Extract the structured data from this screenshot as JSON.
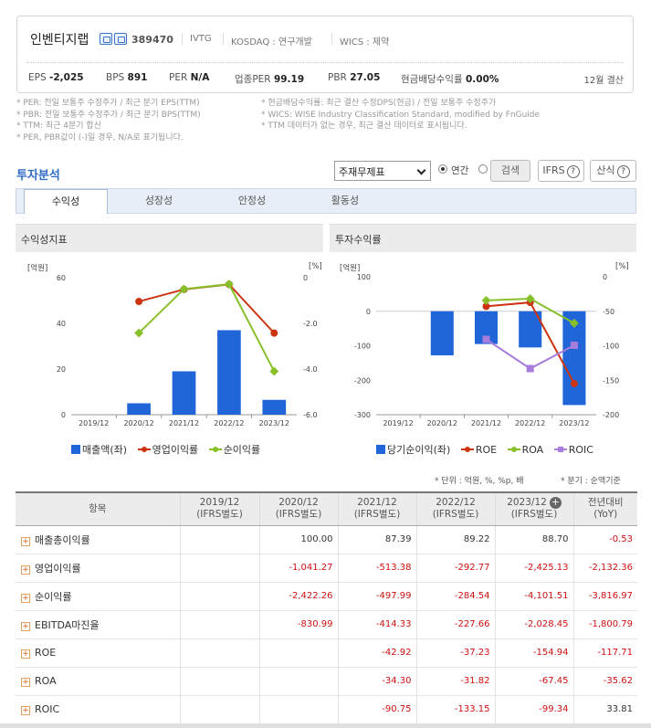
{
  "company": {
    "name": "인벤티지랩",
    "code": "389470",
    "ticker": "IVTG",
    "market": "KOSDAQ : 연구개발",
    "wics": "WICS : 제약",
    "settlement": "12월 결산"
  },
  "metrics": [
    {
      "label": "EPS",
      "value": "-2,025"
    },
    {
      "label": "BPS",
      "value": "891"
    },
    {
      "label": "PER",
      "value": "N/A"
    },
    {
      "label": "업종PER",
      "value": "99.19"
    },
    {
      "label": "PBR",
      "value": "27.05"
    },
    {
      "label": "현금배당수익률",
      "value": "0.00%"
    }
  ],
  "notes_left": [
    "* PER: 전일 보통주 수정주가 / 최근 분기 EPS(TTM)",
    "* PBR: 전일 보통주 수정주가 / 최근 분기 BPS(TTM)",
    "* TTM: 최근 4분기 합산",
    "* PER, PBR값이 (-)일 경우, N/A로 표기됩니다."
  ],
  "notes_right": [
    "* 현금배당수익률: 최근 결산 수정DPS(현금) / 전일 보통주 수정주가",
    "* WICS: WISE Industry Classification Standard, modified by FnGuide",
    "* TTM 데이터가 없는 경우, 최근 결산 데이터로 표시됩니다."
  ],
  "section_title": "투자분석",
  "controls": {
    "select": "주재무제표",
    "radio_annual": "연간",
    "radio_quarter": "분기",
    "search": "검색",
    "ifrs": "IFRS",
    "calc": "산식"
  },
  "tabs": [
    "수익성",
    "성장성",
    "안정성",
    "활동성"
  ],
  "panel_left_title": "수익성지표",
  "panel_right_title": "투자수익률",
  "chart_left_labels": {
    "yleft": "[억원]",
    "yright": "[%]",
    "yleft_ticks": [
      "60",
      "40",
      "20",
      "0"
    ],
    "yright_ticks": [
      "0",
      "-2.0",
      "-4.0",
      "-6.0"
    ]
  },
  "chart_right_labels": {
    "yleft": "[억원]",
    "yright": "[%]",
    "yleft_ticks": [
      "100",
      "0",
      "-100",
      "-200",
      "-300"
    ],
    "yright_ticks": [
      "0",
      "-50",
      "-100",
      "-150",
      "-200"
    ]
  },
  "chart_data": [
    {
      "type": "bar",
      "categories": [
        "2019/12",
        "2020/12",
        "2021/12",
        "2022/12",
        "2023/12"
      ],
      "y_left_unit": "억원",
      "ylim_left": [
        0,
        60
      ],
      "y_right_unit": "%",
      "ylim_right": [
        -6000,
        0
      ],
      "y_right_note": "right axis tick labels printed as -2.0,-4.0,-6.0 (thousand %)",
      "series": [
        {
          "name": "매출액(좌)",
          "type": "bar",
          "axis": "left",
          "color": "#2166d8",
          "values": [
            null,
            5,
            19,
            37,
            6.5
          ]
        },
        {
          "name": "영업이익률",
          "type": "line",
          "axis": "right",
          "color": "#cc3311",
          "values": [
            null,
            -1041.27,
            -513.38,
            -292.77,
            -2425.13
          ]
        },
        {
          "name": "순이익률",
          "type": "line",
          "axis": "right",
          "color": "#88c02a",
          "values": [
            null,
            -2422.26,
            -497.99,
            -284.54,
            -4101.51
          ]
        }
      ]
    },
    {
      "type": "bar",
      "categories": [
        "2019/12",
        "2020/12",
        "2021/12",
        "2022/12",
        "2023/12"
      ],
      "y_left_unit": "억원",
      "ylim_left": [
        -300,
        100
      ],
      "y_right_unit": "%",
      "ylim_right": [
        -200,
        0
      ],
      "series": [
        {
          "name": "당기순이익(좌)",
          "type": "bar",
          "axis": "left",
          "color": "#2166d8",
          "values": [
            null,
            -128,
            -95,
            -105,
            -272
          ]
        },
        {
          "name": "ROE",
          "type": "line",
          "axis": "right",
          "color": "#cc3311",
          "values": [
            null,
            null,
            -42.92,
            -37.23,
            -154.94
          ]
        },
        {
          "name": "ROA",
          "type": "line",
          "axis": "right",
          "color": "#88c02a",
          "values": [
            null,
            null,
            -34.3,
            -31.82,
            -67.45
          ]
        },
        {
          "name": "ROIC",
          "type": "line",
          "axis": "right",
          "color": "#a77cdb",
          "values": [
            null,
            null,
            -90.75,
            -133.15,
            -99.34
          ]
        }
      ]
    }
  ],
  "unit_note_left": "* 단위 : 억원, %, %p, 배",
  "unit_note_right": "* 분기 : 순액기준",
  "table": {
    "headers": [
      "항목",
      "2019/12\n(IFRS별도)",
      "2020/12\n(IFRS별도)",
      "2021/12\n(IFRS별도)",
      "2022/12\n(IFRS별도)",
      "2023/12\n(IFRS별도)",
      "전년대비\n(YoY)"
    ],
    "rows": [
      {
        "label": "매출총이익률",
        "vals": [
          "",
          "100.00",
          "87.39",
          "89.22",
          "88.70",
          "-0.53"
        ]
      },
      {
        "label": "영업이익률",
        "vals": [
          "",
          "-1,041.27",
          "-513.38",
          "-292.77",
          "-2,425.13",
          "-2,132.36"
        ]
      },
      {
        "label": "순이익률",
        "vals": [
          "",
          "-2,422.26",
          "-497.99",
          "-284.54",
          "-4,101.51",
          "-3,816.97"
        ]
      },
      {
        "label": "EBITDA마진율",
        "vals": [
          "",
          "-830.99",
          "-414.33",
          "-227.66",
          "-2,028.45",
          "-1,800.79"
        ]
      },
      {
        "label": "ROE",
        "vals": [
          "",
          "",
          "-42.92",
          "-37.23",
          "-154.94",
          "-117.71"
        ]
      },
      {
        "label": "ROA",
        "vals": [
          "",
          "",
          "-34.30",
          "-31.82",
          "-67.45",
          "-35.62"
        ]
      },
      {
        "label": "ROIC",
        "vals": [
          "",
          "",
          "-90.75",
          "-133.15",
          "-99.34",
          "33.81"
        ]
      }
    ]
  }
}
